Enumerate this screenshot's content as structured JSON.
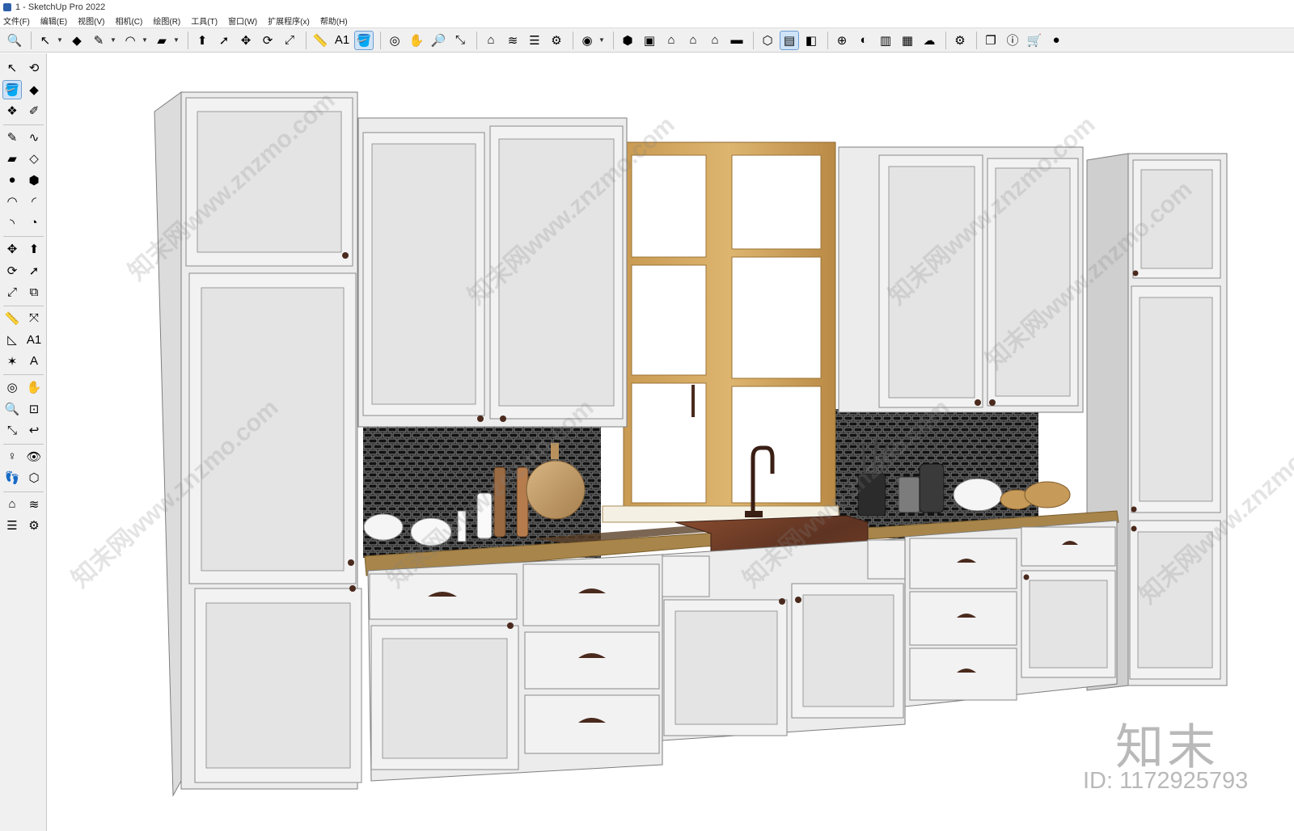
{
  "window": {
    "title": "1 - SketchUp Pro 2022"
  },
  "menu": {
    "items": [
      "文件(F)",
      "编辑(E)",
      "视图(V)",
      "相机(C)",
      "绘图(R)",
      "工具(T)",
      "窗口(W)",
      "扩展程序(x)",
      "帮助(H)"
    ]
  },
  "toolbar": {
    "groups": [
      [
        {
          "icon": "zoom-icon",
          "glyph": "🔍"
        }
      ],
      [
        {
          "icon": "select-icon",
          "glyph": "↖"
        },
        {
          "icon": "dropdown-icon",
          "glyph": "▼"
        },
        {
          "icon": "eraser-icon",
          "glyph": "◆"
        },
        {
          "icon": "pencil-icon",
          "glyph": "✎"
        },
        {
          "icon": "dropdown-icon",
          "glyph": "▼"
        },
        {
          "icon": "arc-icon",
          "glyph": "◠"
        },
        {
          "icon": "dropdown-icon",
          "glyph": "▼"
        },
        {
          "icon": "rectangle-icon",
          "glyph": "▰"
        },
        {
          "icon": "dropdown-icon",
          "glyph": "▼"
        }
      ],
      [
        {
          "icon": "push-pull-icon",
          "glyph": "⬆"
        },
        {
          "icon": "follow-me-icon",
          "glyph": "➚"
        },
        {
          "icon": "move-icon",
          "glyph": "✥"
        },
        {
          "icon": "rotate-icon",
          "glyph": "⟳"
        },
        {
          "icon": "scale-icon",
          "glyph": "⤢"
        }
      ],
      [
        {
          "icon": "tape-measure-icon",
          "glyph": "📏"
        },
        {
          "icon": "text-icon",
          "glyph": "A1"
        },
        {
          "icon": "paint-bucket-icon",
          "glyph": "🪣",
          "active": true
        }
      ],
      [
        {
          "icon": "orbit-icon",
          "glyph": "◎"
        },
        {
          "icon": "pan-icon",
          "glyph": "✋"
        },
        {
          "icon": "zoom-tool-icon",
          "glyph": "🔎"
        },
        {
          "icon": "zoom-extents-icon",
          "glyph": "⤡"
        }
      ],
      [
        {
          "icon": "warehouse-icon",
          "glyph": "⌂"
        },
        {
          "icon": "layers-icon",
          "glyph": "≋"
        },
        {
          "icon": "stack-icon",
          "glyph": "☰"
        },
        {
          "icon": "sandbox-icon",
          "glyph": "⚙"
        }
      ],
      [
        {
          "icon": "user-icon",
          "glyph": "◉"
        },
        {
          "icon": "dropdown-icon",
          "glyph": "▼"
        }
      ],
      [
        {
          "icon": "iso-view-icon",
          "glyph": "⬢"
        },
        {
          "icon": "top-view-icon",
          "glyph": "▣"
        },
        {
          "icon": "front-view-icon",
          "glyph": "⌂"
        },
        {
          "icon": "right-view-icon",
          "glyph": "⌂"
        },
        {
          "icon": "back-view-icon",
          "glyph": "⌂"
        },
        {
          "icon": "left-view-icon",
          "glyph": "▬"
        }
      ],
      [
        {
          "icon": "section-plane-icon",
          "glyph": "⬡"
        },
        {
          "icon": "section-display-icon",
          "glyph": "▤",
          "active": true
        },
        {
          "icon": "section-cut-icon",
          "glyph": "◧"
        }
      ],
      [
        {
          "icon": "add-location-icon",
          "glyph": "⊕"
        },
        {
          "icon": "shadows-icon",
          "glyph": "◐"
        },
        {
          "icon": "styles-icon",
          "glyph": "▥"
        },
        {
          "icon": "fog-icon",
          "glyph": "▦"
        },
        {
          "icon": "cloud-icon",
          "glyph": "☁"
        }
      ],
      [
        {
          "icon": "extension-manager-icon",
          "glyph": "⚙"
        }
      ],
      [
        {
          "icon": "components-icon",
          "glyph": "❐"
        },
        {
          "icon": "info-icon",
          "glyph": "ⓘ"
        },
        {
          "icon": "cart-icon",
          "glyph": "🛒"
        },
        {
          "icon": "account-icon",
          "glyph": "●"
        }
      ]
    ]
  },
  "sidebar": {
    "rows": [
      [
        {
          "icon": "select-icon",
          "glyph": "↖"
        },
        {
          "icon": "lasso-icon",
          "glyph": "⟲"
        }
      ],
      [
        {
          "icon": "paint-bucket-icon",
          "glyph": "🪣",
          "active": true
        },
        {
          "icon": "eraser-icon",
          "glyph": "◆"
        }
      ],
      [
        {
          "icon": "make-component-icon",
          "glyph": "❖"
        },
        {
          "icon": "tag-icon",
          "glyph": "✐"
        }
      ],
      "sep",
      [
        {
          "icon": "pencil-icon",
          "glyph": "✎"
        },
        {
          "icon": "freehand-icon",
          "glyph": "∿"
        }
      ],
      [
        {
          "icon": "rectangle-icon",
          "glyph": "▰"
        },
        {
          "icon": "rotated-rectangle-icon",
          "glyph": "◇"
        }
      ],
      [
        {
          "icon": "circle-icon",
          "glyph": "●"
        },
        {
          "icon": "polygon-icon",
          "glyph": "⬢"
        }
      ],
      [
        {
          "icon": "arc-icon",
          "glyph": "◠"
        },
        {
          "icon": "two-point-arc-icon",
          "glyph": "◜"
        }
      ],
      [
        {
          "icon": "three-point-arc-icon",
          "glyph": "◝"
        },
        {
          "icon": "pie-icon",
          "glyph": "◔"
        }
      ],
      "sep",
      [
        {
          "icon": "move-icon",
          "glyph": "✥"
        },
        {
          "icon": "push-pull-icon",
          "glyph": "⬆"
        }
      ],
      [
        {
          "icon": "rotate-icon",
          "glyph": "⟳"
        },
        {
          "icon": "follow-me-icon",
          "glyph": "➚"
        }
      ],
      [
        {
          "icon": "scale-icon",
          "glyph": "⤢"
        },
        {
          "icon": "offset-icon",
          "glyph": "⧉"
        }
      ],
      "sep",
      [
        {
          "icon": "tape-measure-icon",
          "glyph": "📏"
        },
        {
          "icon": "dimension-icon",
          "glyph": "⤧"
        }
      ],
      [
        {
          "icon": "protractor-icon",
          "glyph": "◺"
        },
        {
          "icon": "text-icon",
          "glyph": "A1"
        }
      ],
      [
        {
          "icon": "axes-icon",
          "glyph": "✶"
        },
        {
          "icon": "3d-text-icon",
          "glyph": "A"
        }
      ],
      "sep",
      [
        {
          "icon": "orbit-icon",
          "glyph": "◎"
        },
        {
          "icon": "pan-icon",
          "glyph": "✋"
        }
      ],
      [
        {
          "icon": "zoom-icon",
          "glyph": "🔍"
        },
        {
          "icon": "zoom-window-icon",
          "glyph": "⊡"
        }
      ],
      [
        {
          "icon": "zoom-extents-icon",
          "glyph": "⤡"
        },
        {
          "icon": "previous-view-icon",
          "glyph": "↩"
        }
      ],
      "sep",
      [
        {
          "icon": "position-camera-icon",
          "glyph": "♀"
        },
        {
          "icon": "look-around-icon",
          "glyph": "👁"
        }
      ],
      [
        {
          "icon": "walk-icon",
          "glyph": "👣"
        },
        {
          "icon": "section-plane-icon",
          "glyph": "⬡"
        }
      ],
      "sep",
      [
        {
          "icon": "warehouse-icon",
          "glyph": "⌂"
        },
        {
          "icon": "layers-icon",
          "glyph": "≋"
        }
      ],
      [
        {
          "icon": "stack-icon",
          "glyph": "☰"
        },
        {
          "icon": "sandbox-icon",
          "glyph": "⚙"
        }
      ]
    ]
  },
  "viewport": {
    "watermarks": [
      "知末网www.znzmo.com",
      "知末网www.znzmo.com",
      "知末网www.znzmo.com",
      "知末网www.znzmo.com",
      "知末网www.znzmo.com",
      "知末网www.znzmo.com",
      "知末网www.znzmo.com",
      "知末网www.znzmo.com"
    ],
    "logo": "知末",
    "id_label": "ID: 1172925793"
  },
  "colors": {
    "cabinet": "#ececec",
    "cabinet_edge": "#7e7e7e",
    "tile": "#141414",
    "counter": "#a8854a",
    "window_frame": "#c99a52",
    "sink": "#6e3f28",
    "handle": "#4a2a1d"
  }
}
